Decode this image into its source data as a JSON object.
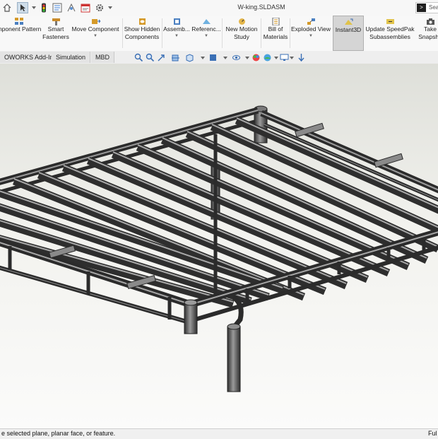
{
  "window": {
    "title": "W-king.SLDASM",
    "search_placeholder": "Sea"
  },
  "quick_access": [
    {
      "name": "home-icon"
    },
    {
      "name": "select-arrow-icon"
    },
    {
      "name": "rebuild-traffic-light-icon"
    },
    {
      "name": "file-properties-icon"
    },
    {
      "name": "drawing-icon"
    },
    {
      "name": "print-icon"
    },
    {
      "name": "options-gear-icon"
    }
  ],
  "ribbon": {
    "buttons": [
      {
        "label": "mponent Pattern",
        "has_dropdown": false
      },
      {
        "label": "Smart\nFasteners",
        "has_dropdown": false
      },
      {
        "label": "Move Component",
        "has_dropdown": true
      },
      {
        "label": "Show Hidden\nComponents",
        "has_dropdown": false
      },
      {
        "label": "Assemb...",
        "has_dropdown": true
      },
      {
        "label": "Referenc...",
        "has_dropdown": true
      },
      {
        "label": "New Motion\nStudy",
        "has_dropdown": false
      },
      {
        "label": "Bill of\nMaterials",
        "has_dropdown": false
      },
      {
        "label": "Exploded View",
        "has_dropdown": true
      },
      {
        "label": "Instant3D",
        "has_dropdown": false,
        "active": true
      },
      {
        "label": "Update SpeedPak\nSubassemblies",
        "has_dropdown": false
      },
      {
        "label": "Take\nSnapsho",
        "has_dropdown": false
      }
    ]
  },
  "tabs": [
    {
      "label": "OWORKS Add-Ins"
    },
    {
      "label": "Simulation"
    },
    {
      "label": "MBD"
    }
  ],
  "heads_up_toolbar": [
    "zoom-to-fit-icon",
    "zoom-area-icon",
    "previous-view-icon",
    "section-view-icon",
    "view-orientation-icon",
    "display-style-icon",
    "hide-show-items-icon",
    "edit-appearance-icon",
    "apply-scene-icon",
    "view-settings-icon",
    "display-pane-icon"
  ],
  "status": {
    "message": "e selected plane, planar face, or feature.",
    "right": "Ful"
  },
  "colors": {
    "accent": "#cfdde9",
    "active_button": "#d5d5d5",
    "tube_dark": "#3a3a3a",
    "tube_light": "#8a8a8a"
  }
}
